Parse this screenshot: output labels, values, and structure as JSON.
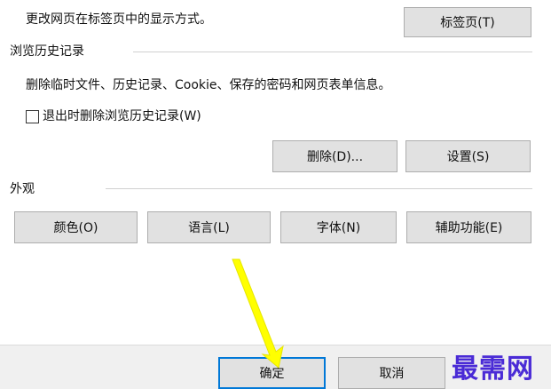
{
  "tabs_section": {
    "description": "更改网页在标签页中的显示方式。",
    "tabs_button_label": "标签页(T)"
  },
  "history_section": {
    "heading": "浏览历史记录",
    "description": "删除临时文件、历史记录、Cookie、保存的密码和网页表单信息。",
    "delete_on_exit_label": "退出时删除浏览历史记录(W)",
    "delete_on_exit_checked": false,
    "delete_button_label": "删除(D)...",
    "settings_button_label": "设置(S)"
  },
  "appearance_section": {
    "heading": "外观",
    "colors_label": "颜色(O)",
    "languages_label": "语言(L)",
    "fonts_label": "字体(N)",
    "accessibility_label": "辅助功能(E)"
  },
  "footer": {
    "ok_label": "确定",
    "cancel_label": "取消"
  },
  "watermark": {
    "text": "最需网"
  },
  "colors": {
    "button_face": "#e1e1e1",
    "button_border": "#adadad",
    "default_button_border": "#0078d7",
    "annotation_arrow": "#ffff00",
    "watermark": "#4a2bd6"
  }
}
